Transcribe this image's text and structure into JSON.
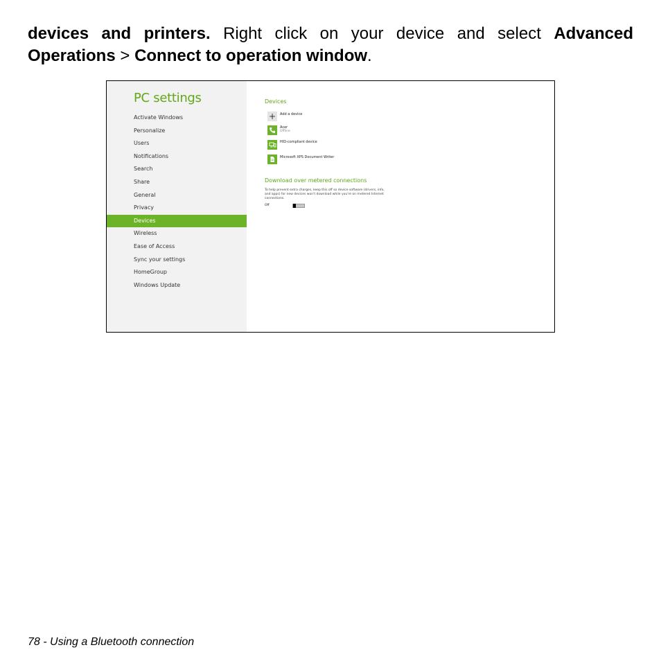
{
  "intro": {
    "bold1": "devices and printers.",
    "text1": " Right click on your device and select ",
    "bold2": "Advanced Operations",
    "text2": " > ",
    "bold3": "Connect to operation window",
    "text3": "."
  },
  "settings": {
    "title": "PC settings",
    "nav": [
      "Activate Windows",
      "Personalize",
      "Users",
      "Notifications",
      "Search",
      "Share",
      "General",
      "Privacy",
      "Devices",
      "Wireless",
      "Ease of Access",
      "Sync your settings",
      "HomeGroup",
      "Windows Update"
    ],
    "selected_nav": "Devices",
    "devices_heading": "Devices",
    "add_device": "Add a device",
    "devices": [
      {
        "name": "Acer",
        "status": "Offline",
        "icon": "phone-icon"
      },
      {
        "name": "HID-compliant device",
        "status": "",
        "icon": "monitor-icon"
      },
      {
        "name": "Microsoft XPS Document Writer",
        "status": "",
        "icon": "document-icon"
      }
    ],
    "metered_heading": "Download over metered connections",
    "metered_desc": "To help prevent extra charges, keep this off so device software (drivers, info, and apps) for new devices won't download while you're on metered Internet connections.",
    "toggle_state": "Off",
    "accent_color": "#6db32a"
  },
  "footer": {
    "text": "78 - Using a Bluetooth connection"
  }
}
